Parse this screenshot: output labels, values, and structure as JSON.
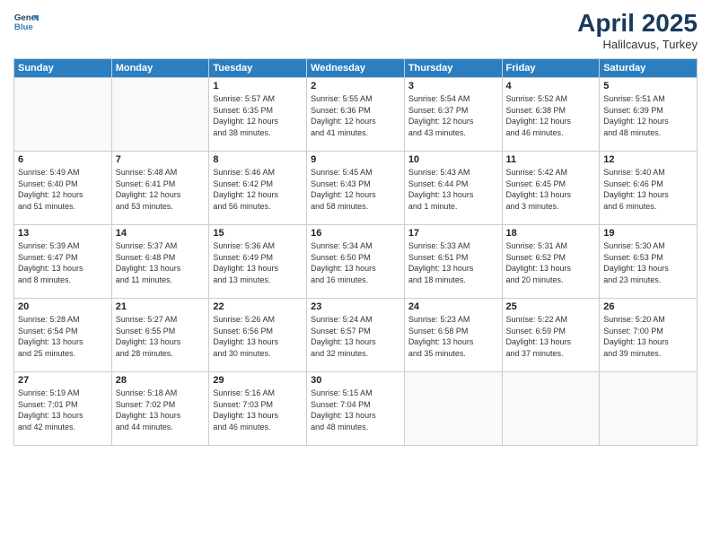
{
  "logo": {
    "line1": "General",
    "line2": "Blue"
  },
  "title": "April 2025",
  "location": "Halilcavus, Turkey",
  "weekdays": [
    "Sunday",
    "Monday",
    "Tuesday",
    "Wednesday",
    "Thursday",
    "Friday",
    "Saturday"
  ],
  "weeks": [
    [
      {
        "day": "",
        "info": ""
      },
      {
        "day": "",
        "info": ""
      },
      {
        "day": "1",
        "info": "Sunrise: 5:57 AM\nSunset: 6:35 PM\nDaylight: 12 hours\nand 38 minutes."
      },
      {
        "day": "2",
        "info": "Sunrise: 5:55 AM\nSunset: 6:36 PM\nDaylight: 12 hours\nand 41 minutes."
      },
      {
        "day": "3",
        "info": "Sunrise: 5:54 AM\nSunset: 6:37 PM\nDaylight: 12 hours\nand 43 minutes."
      },
      {
        "day": "4",
        "info": "Sunrise: 5:52 AM\nSunset: 6:38 PM\nDaylight: 12 hours\nand 46 minutes."
      },
      {
        "day": "5",
        "info": "Sunrise: 5:51 AM\nSunset: 6:39 PM\nDaylight: 12 hours\nand 48 minutes."
      }
    ],
    [
      {
        "day": "6",
        "info": "Sunrise: 5:49 AM\nSunset: 6:40 PM\nDaylight: 12 hours\nand 51 minutes."
      },
      {
        "day": "7",
        "info": "Sunrise: 5:48 AM\nSunset: 6:41 PM\nDaylight: 12 hours\nand 53 minutes."
      },
      {
        "day": "8",
        "info": "Sunrise: 5:46 AM\nSunset: 6:42 PM\nDaylight: 12 hours\nand 56 minutes."
      },
      {
        "day": "9",
        "info": "Sunrise: 5:45 AM\nSunset: 6:43 PM\nDaylight: 12 hours\nand 58 minutes."
      },
      {
        "day": "10",
        "info": "Sunrise: 5:43 AM\nSunset: 6:44 PM\nDaylight: 13 hours\nand 1 minute."
      },
      {
        "day": "11",
        "info": "Sunrise: 5:42 AM\nSunset: 6:45 PM\nDaylight: 13 hours\nand 3 minutes."
      },
      {
        "day": "12",
        "info": "Sunrise: 5:40 AM\nSunset: 6:46 PM\nDaylight: 13 hours\nand 6 minutes."
      }
    ],
    [
      {
        "day": "13",
        "info": "Sunrise: 5:39 AM\nSunset: 6:47 PM\nDaylight: 13 hours\nand 8 minutes."
      },
      {
        "day": "14",
        "info": "Sunrise: 5:37 AM\nSunset: 6:48 PM\nDaylight: 13 hours\nand 11 minutes."
      },
      {
        "day": "15",
        "info": "Sunrise: 5:36 AM\nSunset: 6:49 PM\nDaylight: 13 hours\nand 13 minutes."
      },
      {
        "day": "16",
        "info": "Sunrise: 5:34 AM\nSunset: 6:50 PM\nDaylight: 13 hours\nand 16 minutes."
      },
      {
        "day": "17",
        "info": "Sunrise: 5:33 AM\nSunset: 6:51 PM\nDaylight: 13 hours\nand 18 minutes."
      },
      {
        "day": "18",
        "info": "Sunrise: 5:31 AM\nSunset: 6:52 PM\nDaylight: 13 hours\nand 20 minutes."
      },
      {
        "day": "19",
        "info": "Sunrise: 5:30 AM\nSunset: 6:53 PM\nDaylight: 13 hours\nand 23 minutes."
      }
    ],
    [
      {
        "day": "20",
        "info": "Sunrise: 5:28 AM\nSunset: 6:54 PM\nDaylight: 13 hours\nand 25 minutes."
      },
      {
        "day": "21",
        "info": "Sunrise: 5:27 AM\nSunset: 6:55 PM\nDaylight: 13 hours\nand 28 minutes."
      },
      {
        "day": "22",
        "info": "Sunrise: 5:26 AM\nSunset: 6:56 PM\nDaylight: 13 hours\nand 30 minutes."
      },
      {
        "day": "23",
        "info": "Sunrise: 5:24 AM\nSunset: 6:57 PM\nDaylight: 13 hours\nand 32 minutes."
      },
      {
        "day": "24",
        "info": "Sunrise: 5:23 AM\nSunset: 6:58 PM\nDaylight: 13 hours\nand 35 minutes."
      },
      {
        "day": "25",
        "info": "Sunrise: 5:22 AM\nSunset: 6:59 PM\nDaylight: 13 hours\nand 37 minutes."
      },
      {
        "day": "26",
        "info": "Sunrise: 5:20 AM\nSunset: 7:00 PM\nDaylight: 13 hours\nand 39 minutes."
      }
    ],
    [
      {
        "day": "27",
        "info": "Sunrise: 5:19 AM\nSunset: 7:01 PM\nDaylight: 13 hours\nand 42 minutes."
      },
      {
        "day": "28",
        "info": "Sunrise: 5:18 AM\nSunset: 7:02 PM\nDaylight: 13 hours\nand 44 minutes."
      },
      {
        "day": "29",
        "info": "Sunrise: 5:16 AM\nSunset: 7:03 PM\nDaylight: 13 hours\nand 46 minutes."
      },
      {
        "day": "30",
        "info": "Sunrise: 5:15 AM\nSunset: 7:04 PM\nDaylight: 13 hours\nand 48 minutes."
      },
      {
        "day": "",
        "info": ""
      },
      {
        "day": "",
        "info": ""
      },
      {
        "day": "",
        "info": ""
      }
    ]
  ]
}
